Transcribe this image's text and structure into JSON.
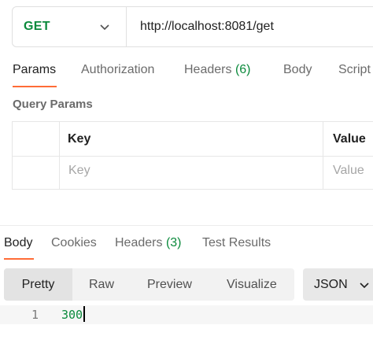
{
  "request": {
    "method": "GET",
    "url": "http://localhost:8081/get",
    "tabs": [
      {
        "label": "Params",
        "count": ""
      },
      {
        "label": "Authorization",
        "count": ""
      },
      {
        "label": "Headers",
        "count": "(6)"
      },
      {
        "label": "Body",
        "count": ""
      },
      {
        "label": "Script",
        "count": ""
      }
    ],
    "active_tab": "Params"
  },
  "query_params": {
    "title": "Query Params",
    "columns": [
      "Key",
      "Value"
    ],
    "placeholders": {
      "key": "Key",
      "value": "Value"
    }
  },
  "response": {
    "tabs": [
      {
        "label": "Body",
        "count": ""
      },
      {
        "label": "Cookies",
        "count": ""
      },
      {
        "label": "Headers",
        "count": "(3)"
      },
      {
        "label": "Test Results",
        "count": ""
      }
    ],
    "active_tab": "Body",
    "view_modes": [
      "Pretty",
      "Raw",
      "Preview",
      "Visualize"
    ],
    "selected_view": "Pretty",
    "format": "JSON",
    "lines": [
      {
        "number": "1",
        "text": "300"
      }
    ]
  },
  "colors": {
    "accent": "#ff6c37",
    "method_get": "#0b8a3c",
    "count_green": "#0b8a3c"
  },
  "icons": {
    "dropdown": "chevron-down-icon"
  }
}
